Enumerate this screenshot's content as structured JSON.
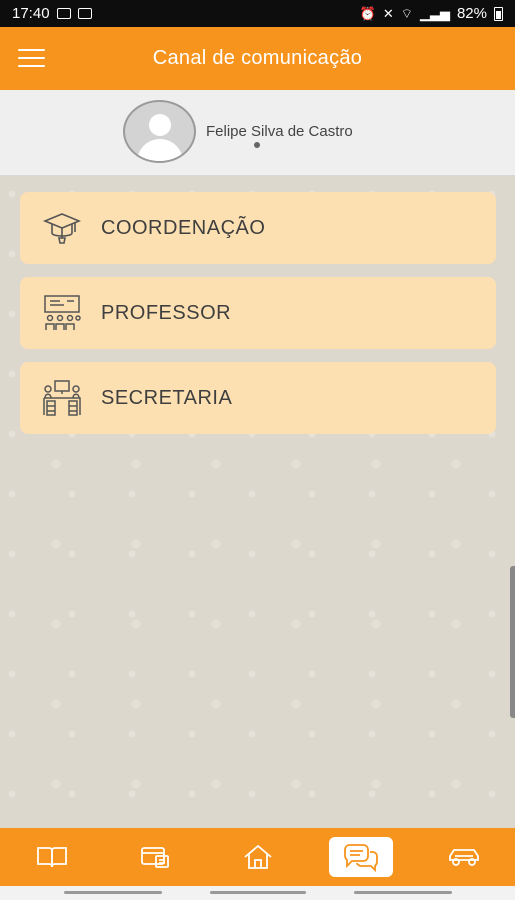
{
  "status_bar": {
    "time": "17:40",
    "battery": "82%"
  },
  "app_bar": {
    "title": "Canal de comunicação"
  },
  "profile": {
    "name": "Felipe Silva de Castro"
  },
  "channels": [
    {
      "label": "COORDENAÇÃO",
      "icon": "graduation-cap-icon"
    },
    {
      "label": "PROFESSOR",
      "icon": "teacher-classroom-icon"
    },
    {
      "label": "SECRETARIA",
      "icon": "office-desk-icon"
    }
  ],
  "bottom_nav": {
    "active": "chat",
    "items": [
      "book-icon",
      "bus-pass-icon",
      "home-icon",
      "chat-icon",
      "car-icon"
    ]
  },
  "colors": {
    "primary": "#f7941d",
    "card": "#fde0b2",
    "icon_stroke": "#555555"
  }
}
